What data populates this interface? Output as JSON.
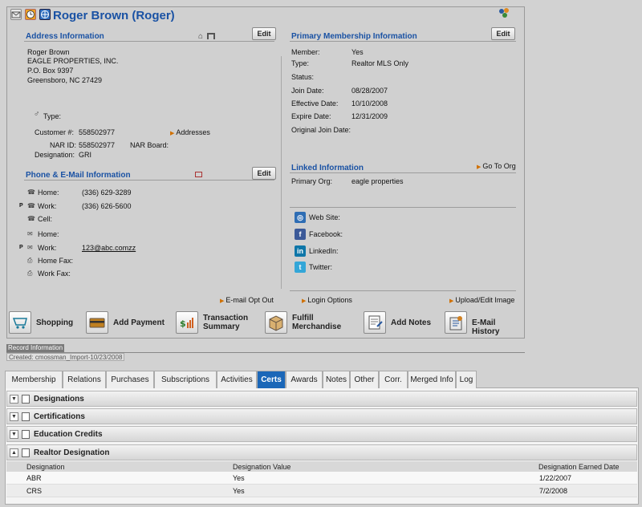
{
  "header": {
    "title": "Roger Brown (Roger)"
  },
  "address": {
    "section": "Address Information",
    "edit": "Edit",
    "lines": [
      "Roger Brown",
      "EAGLE PROPERTIES, INC.",
      "P.O. Box 9397",
      "Greensboro, NC 27429"
    ],
    "type_label": "Type:",
    "customer_label": "Customer #:",
    "customer_value": "558502977",
    "addresses_link": "Addresses",
    "nar_id_label": "NAR ID:",
    "nar_id_value": "558502977",
    "nar_board_label": "NAR Board:",
    "designation_label": "Designation:",
    "designation_value": "GRI"
  },
  "phone": {
    "section": "Phone & E-Mail Information",
    "edit": "Edit",
    "rows": [
      {
        "label": "Home:",
        "value": "(336) 629-3289",
        "marker": ""
      },
      {
        "label": "Work:",
        "value": "(336) 626-5600",
        "marker": "P"
      },
      {
        "label": "Cell:",
        "value": "",
        "marker": ""
      },
      {
        "label": "Home:",
        "value": "",
        "marker": ""
      },
      {
        "label": "Work:",
        "value": "123@abc.comzz",
        "marker": "P"
      },
      {
        "label": "Home Fax:",
        "value": "",
        "marker": ""
      },
      {
        "label": "Work Fax:",
        "value": "",
        "marker": ""
      }
    ],
    "optout": "E-mail Opt Out"
  },
  "membership": {
    "section": "Primary Membership Information",
    "edit": "Edit",
    "rows": [
      {
        "label": "Member:",
        "value": "Yes"
      },
      {
        "label": "Type:",
        "value": "Realtor MLS Only"
      },
      {
        "label": "Status:",
        "value": ""
      },
      {
        "label": "Join Date:",
        "value": "08/28/2007"
      },
      {
        "label": "Effective Date:",
        "value": "10/10/2008"
      },
      {
        "label": "Expire Date:",
        "value": "12/31/2009"
      },
      {
        "label": "Original Join Date:",
        "value": ""
      }
    ]
  },
  "linked": {
    "section": "Linked Information",
    "goto": "Go To Org",
    "org_label": "Primary Org:",
    "org_value": "eagle properties"
  },
  "social": [
    {
      "label": "Web Site:",
      "icon": "globe-icon",
      "color": "#2e6db4"
    },
    {
      "label": "Facebook:",
      "icon": "facebook-icon",
      "color": "#3b5998"
    },
    {
      "label": "LinkedIn:",
      "icon": "linkedin-icon",
      "color": "#0e76a8"
    },
    {
      "label": "Twitter:",
      "icon": "twitter-icon",
      "color": "#33a6d8"
    }
  ],
  "login_options": "Login Options",
  "upload_image": "Upload/Edit Image",
  "actions": [
    "Shopping",
    "Add Payment",
    "Transaction Summary",
    "Fulfill Merchandise",
    "Add Notes",
    "E-Mail History"
  ],
  "record": {
    "label": "Record Information",
    "created": "Created: cmossman_Import-10/23/2008"
  },
  "tabs": [
    "Membership",
    "Relations",
    "Purchases",
    "Subscriptions",
    "Activities",
    "Certs",
    "Awards",
    "Notes",
    "Other",
    "Corr.",
    "Merged Info",
    "Log"
  ],
  "active_tab": "Certs",
  "groups": [
    "Designations",
    "Certifications",
    "Education Credits",
    "Realtor Designation"
  ],
  "table": {
    "headers": [
      "Designation",
      "Designation Value",
      "Designation Earned Date"
    ],
    "rows": [
      [
        "ABR",
        "Yes",
        "1/22/2007"
      ],
      [
        "CRS",
        "Yes",
        "7/2/2008"
      ]
    ]
  },
  "colors": {
    "accent": "#1a52a4",
    "active_tab": "#1b67b8",
    "link_arrow": "#d07000"
  }
}
